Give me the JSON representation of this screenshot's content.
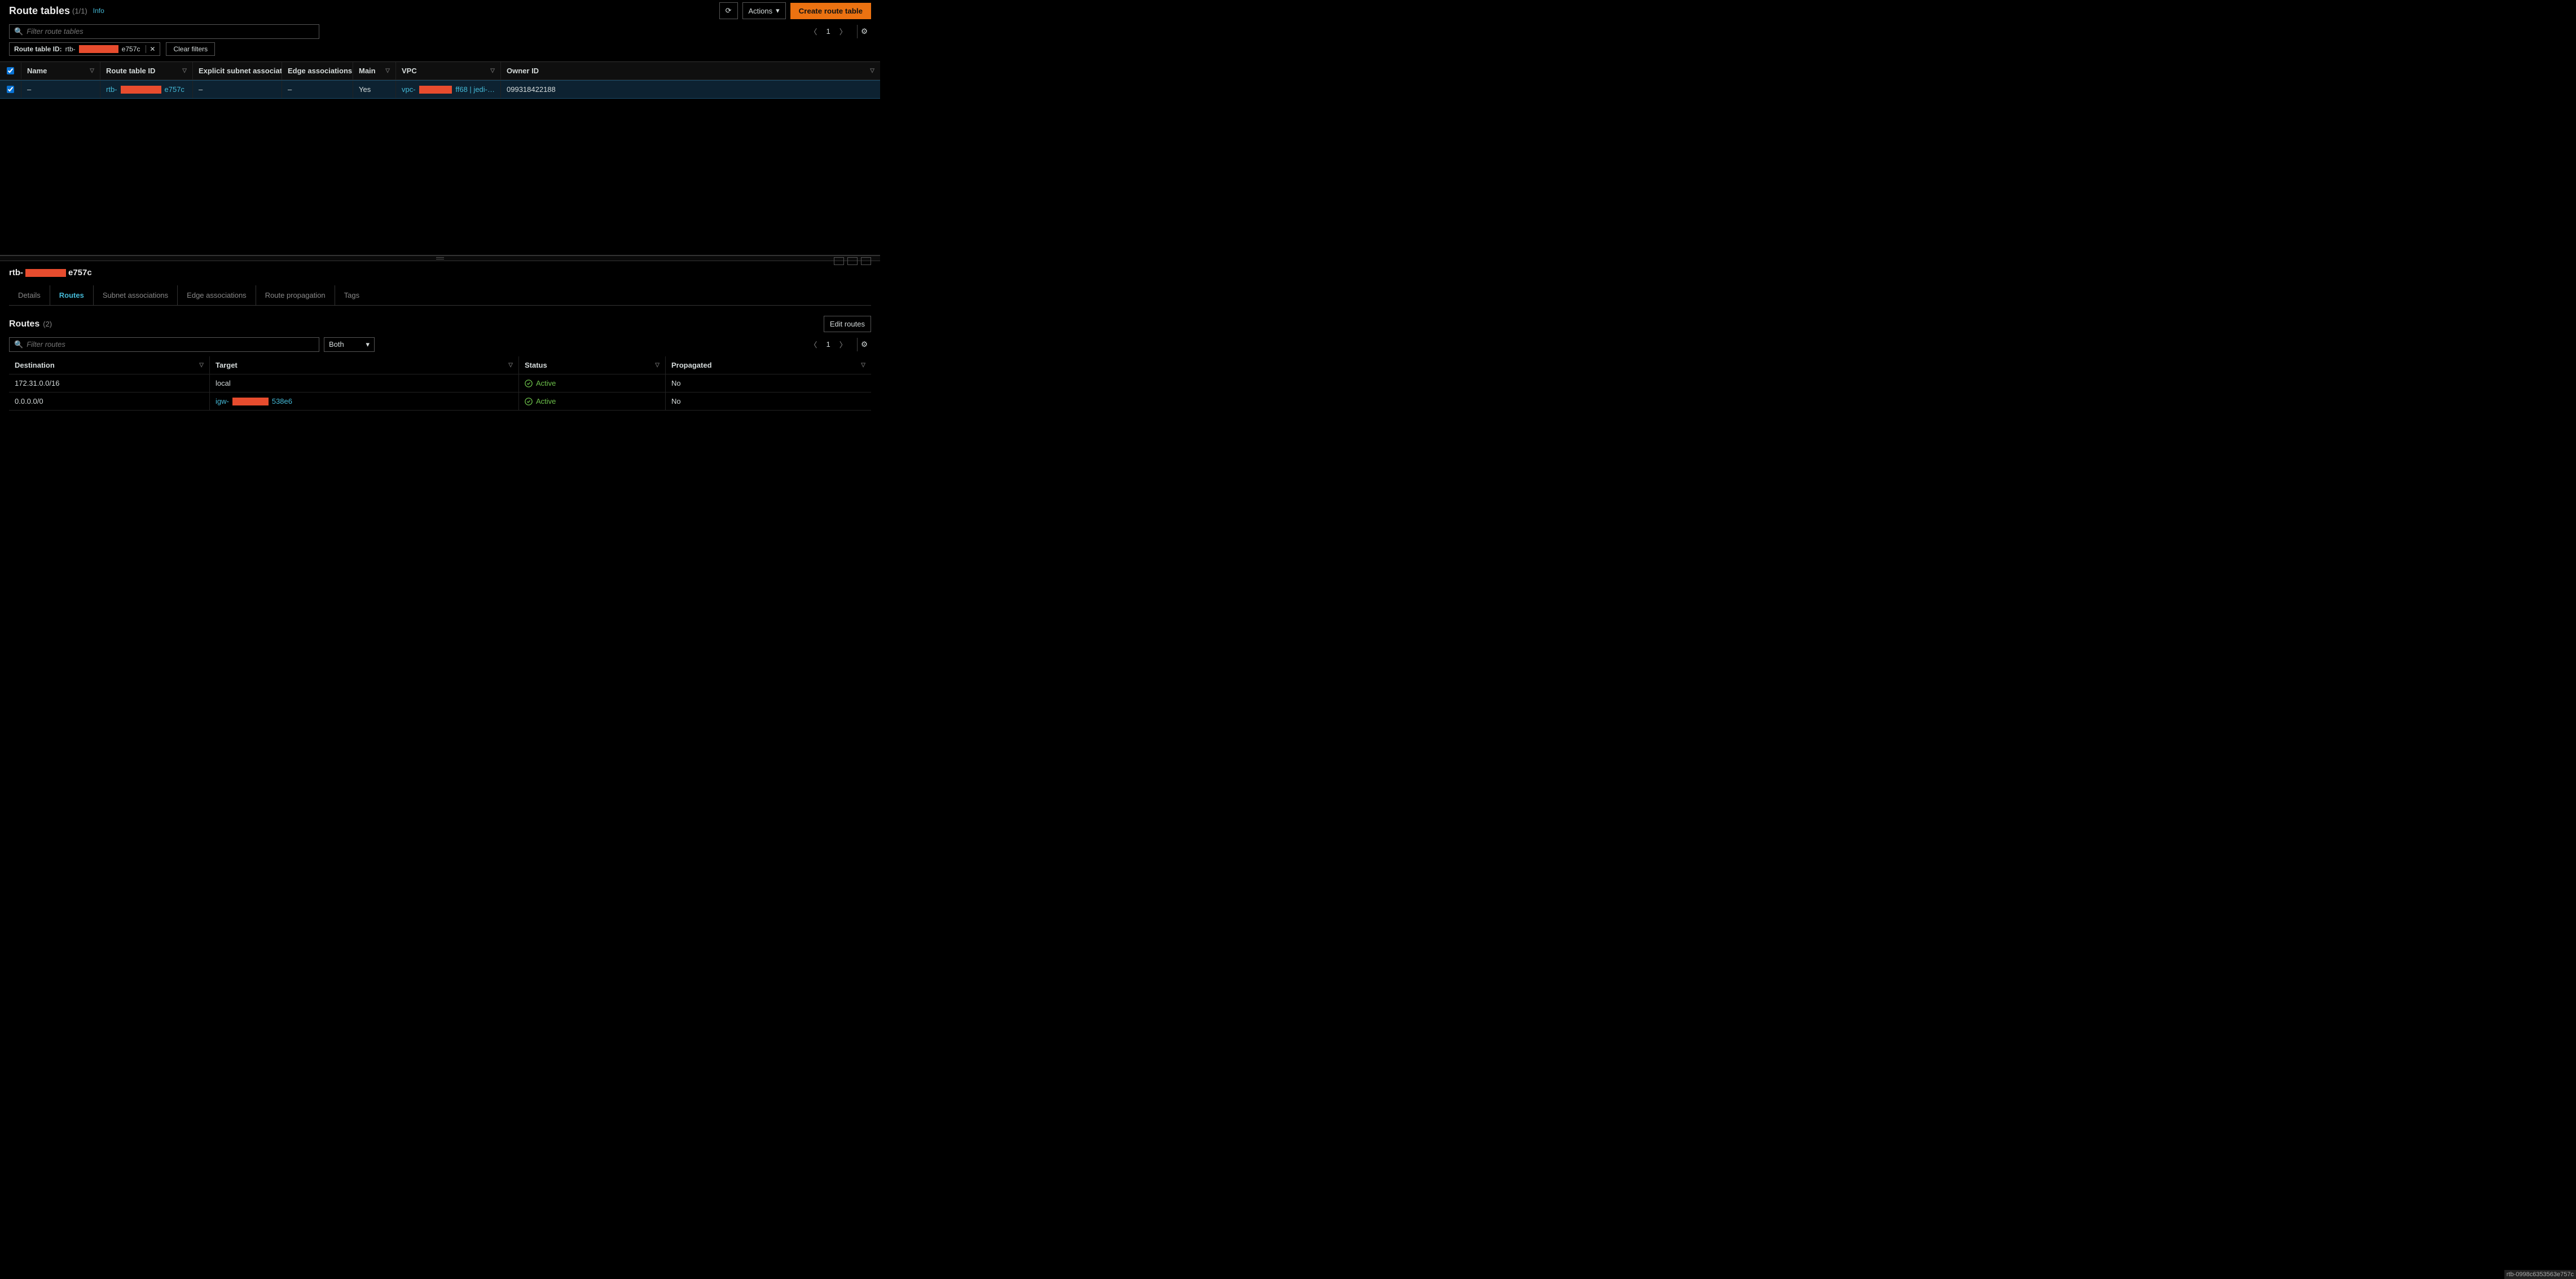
{
  "header": {
    "title": "Route tables",
    "count": "(1/1)",
    "info": "Info",
    "actions": "Actions",
    "create": "Create route table"
  },
  "search": {
    "placeholder": "Filter route tables",
    "page": "1"
  },
  "filter_chip": {
    "key": "Route table ID:",
    "prefix": "rtb-",
    "suffix": "e757c"
  },
  "clear_filters": "Clear filters",
  "table": {
    "cols": {
      "name": "Name",
      "rtid": "Route table ID",
      "esa": "Explicit subnet associat…",
      "ea": "Edge associations",
      "main": "Main",
      "vpc": "VPC",
      "own": "Owner ID"
    },
    "row": {
      "name": "–",
      "rt_prefix": "rtb-",
      "rt_suffix": "e757c",
      "esa": "–",
      "ea": "–",
      "main": "Yes",
      "vpc_prefix": "vpc-",
      "vpc_suffix": "ff68 | jedi-…",
      "own": "099318422188"
    }
  },
  "detail": {
    "title_prefix": "rtb-",
    "title_suffix": "e757c",
    "tabs": {
      "details": "Details",
      "routes": "Routes",
      "subnet": "Subnet associations",
      "edge": "Edge associations",
      "prop": "Route propagation",
      "tags": "Tags"
    },
    "routes_title": "Routes",
    "routes_count": "(2)",
    "edit": "Edit routes",
    "filter_placeholder": "Filter routes",
    "both": "Both",
    "page": "1",
    "cols": {
      "dest": "Destination",
      "targ": "Target",
      "stat": "Status",
      "prop": "Propagated"
    },
    "rows": [
      {
        "dest": "172.31.0.0/16",
        "targ_plain": "local",
        "status": "Active",
        "prop": "No"
      },
      {
        "dest": "0.0.0.0/0",
        "targ_prefix": "igw-",
        "targ_suffix": "538e6",
        "status": "Active",
        "prop": "No"
      }
    ]
  },
  "footer_hint": "rtb-0998c6353563e757c"
}
